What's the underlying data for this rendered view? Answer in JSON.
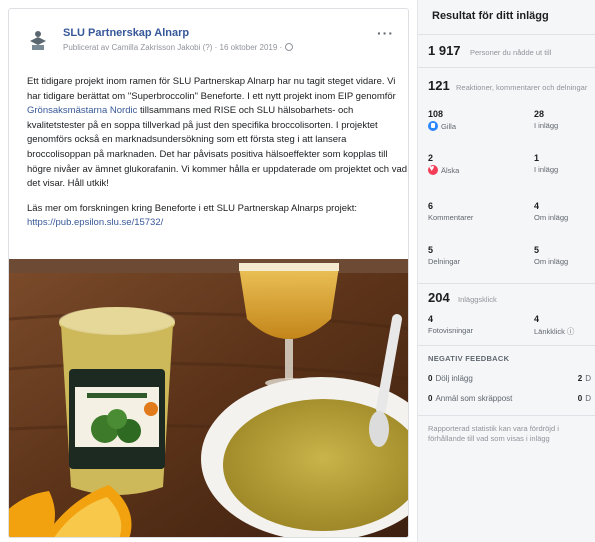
{
  "post": {
    "page_name": "SLU Partnerskap Alnarp",
    "meta": "Publicerat av Camilla Zakrisson Jakobi (?) · 16 oktober 2019 ·",
    "menu_glyph": "···",
    "paragraph_1": "Ett tidigare projekt inom ramen för SLU Partnerskap Alnarp har nu tagit steget vidare. Vi har tidigare berättat om \"Superbroccolin\" Beneforte. I ett nytt projekt inom EIP genomför",
    "link_1": "Grönsaksmästarna Nordic",
    "paragraph_1_tail": "tillsammans med RISE och SLU hälsobarhets- och kvalitetstester på en soppa tillverkad på just den specifika broccolisorten. I projektet genomförs också en marknadsundersökning som ett första steg i att lansera broccolisoppan på marknaden. Det har påvisats positiva hälsoeffekter som kopplas till högre nivåer av ämnet glukorafanin. Vi kommer hålla er uppdaterade om projektet och vad det visar. Håll utkik!",
    "paragraph_2": "Läs mer om forskningen kring Beneforte i ett SLU Partnerskap Alnarps projekt:",
    "link_2": "https://pub.epsilon.slu.se/15732/"
  },
  "insights": {
    "title": "Resultat för ditt inlägg",
    "reach": {
      "value": "1 917",
      "label": "Personer du nådde ut till"
    },
    "engagement": {
      "value": "121",
      "label": "Reaktioner, kommentarer och delningar"
    },
    "reactions": [
      {
        "value": "108",
        "label": "Gilla",
        "icon": "like-icon"
      },
      {
        "value": "28",
        "label": "I inlägg",
        "icon": ""
      },
      {
        "value": "2",
        "label": "Älska",
        "icon": "love-icon"
      },
      {
        "value": "1",
        "label": "I inlägg",
        "icon": ""
      },
      {
        "value": "6",
        "label": "Kommentarer",
        "icon": ""
      },
      {
        "value": "4",
        "label": "Om inlägg",
        "icon": ""
      },
      {
        "value": "5",
        "label": "Delningar",
        "icon": ""
      },
      {
        "value": "5",
        "label": "Om inlägg",
        "icon": ""
      }
    ],
    "clicks": {
      "value": "204",
      "label": "Inläggsklick"
    },
    "click_types": [
      {
        "value": "4",
        "label": "Fotovisningar"
      },
      {
        "value": "4",
        "label": "Länkklick ⓘ"
      }
    ],
    "negative": {
      "title": "NEGATIV FEEDBACK",
      "rows": [
        {
          "left_value": "0",
          "left_label": "Dölj inlägg",
          "right_value": "2",
          "right_label": "D"
        },
        {
          "left_value": "0",
          "left_label": "Anmäl som skräppost",
          "right_value": "0",
          "right_label": "D"
        }
      ]
    },
    "footnote": "Rapporterad statistik kan vara fördröjd i förhållande till vad som visas i inlägg"
  }
}
